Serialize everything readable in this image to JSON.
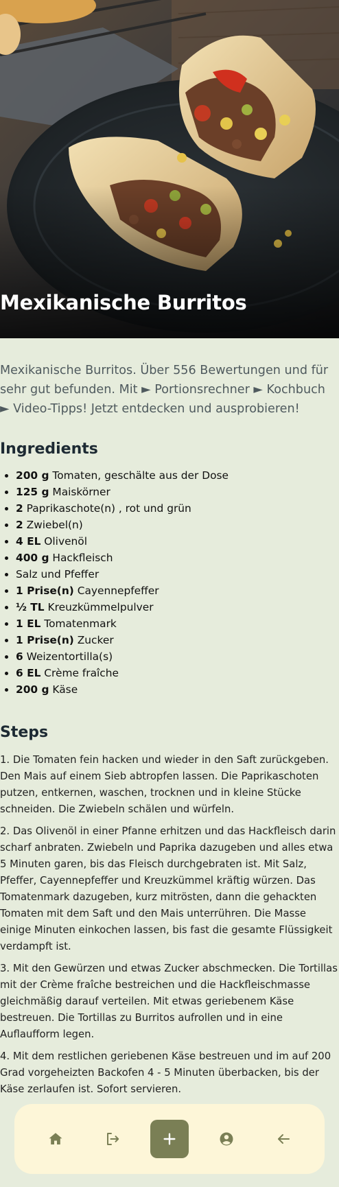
{
  "recipe": {
    "title": "Mexikanische Burritos",
    "description": "Mexikanische Burritos. Über 556 Bewertungen und für sehr gut befunden. Mit ► Portionsrechner ► Kochbuch ► Video-Tipps! Jetzt entdecken und ausprobieren!",
    "ingredients_heading": "Ingredients",
    "ingredients": [
      {
        "amount": "200 g",
        "name": "Tomaten, geschälte aus der Dose"
      },
      {
        "amount": "125 g",
        "name": "Maiskörner"
      },
      {
        "amount": "2",
        "name": "Paprikaschote(n) , rot und grün"
      },
      {
        "amount": "2",
        "name": "Zwiebel(n)"
      },
      {
        "amount": "4 EL",
        "name": "Olivenöl"
      },
      {
        "amount": "400 g",
        "name": "Hackfleisch"
      },
      {
        "amount": "",
        "name": "Salz und Pfeffer"
      },
      {
        "amount": "1 Prise(n)",
        "name": "Cayennepfeffer"
      },
      {
        "amount": "½ TL",
        "name": "Kreuzkümmelpulver"
      },
      {
        "amount": "1 EL",
        "name": "Tomatenmark"
      },
      {
        "amount": "1 Prise(n)",
        "name": "Zucker"
      },
      {
        "amount": "6",
        "name": "Weizentortilla(s)"
      },
      {
        "amount": "6 EL",
        "name": "Crème fraîche"
      },
      {
        "amount": "200 g",
        "name": "Käse"
      }
    ],
    "steps_heading": "Steps",
    "steps": [
      "1. Die Tomaten fein hacken und wieder in den Saft zurückgeben. Den Mais auf einem Sieb abtropfen lassen. Die Paprikaschoten putzen, entkernen, waschen, trocknen und in kleine Stücke schneiden. Die Zwiebeln schälen und würfeln.",
      "2. Das Olivenöl in einer Pfanne erhitzen und das Hackfleisch darin scharf anbraten. Zwiebeln und Paprika dazugeben und alles etwa 5 Minuten garen, bis das Fleisch durchgebraten ist. Mit Salz, Pfeffer, Cayennepfeffer und Kreuzkümmel kräftig würzen. Das Tomatenmark dazugeben, kurz mitrösten, dann die gehackten Tomaten mit dem Saft und den Mais unterrühren. Die Masse einige Minuten einkochen lassen, bis fast die gesamte Flüssigkeit verdampft ist.",
      "3. Mit den Gewürzen und etwas Zucker abschmecken. Die Tortillas mit der Crème fraîche bestreichen und die Hackfleischmasse gleichmäßig darauf verteilen. Mit etwas geriebenem Käse bestreuen. Die Tortillas zu Burritos aufrollen und in eine Auflaufform legen.",
      "4. Mit dem restlichen geriebenen Käse bestreuen und im auf 200 Grad vorgeheizten Backofen 4 - 5 Minuten überbacken, bis der Käse zerlaufen ist. Sofort servieren."
    ]
  },
  "bottom_nav": {
    "items": [
      {
        "icon": "home-icon"
      },
      {
        "icon": "logout-icon"
      },
      {
        "icon": "plus-icon"
      },
      {
        "icon": "account-icon"
      },
      {
        "icon": "arrow-left-icon"
      }
    ]
  },
  "colors": {
    "page_background": "#e6ecdc",
    "nav_background": "#fdf6d8",
    "nav_primary": "#7a7f55",
    "nav_icon": "#7a7f55"
  }
}
